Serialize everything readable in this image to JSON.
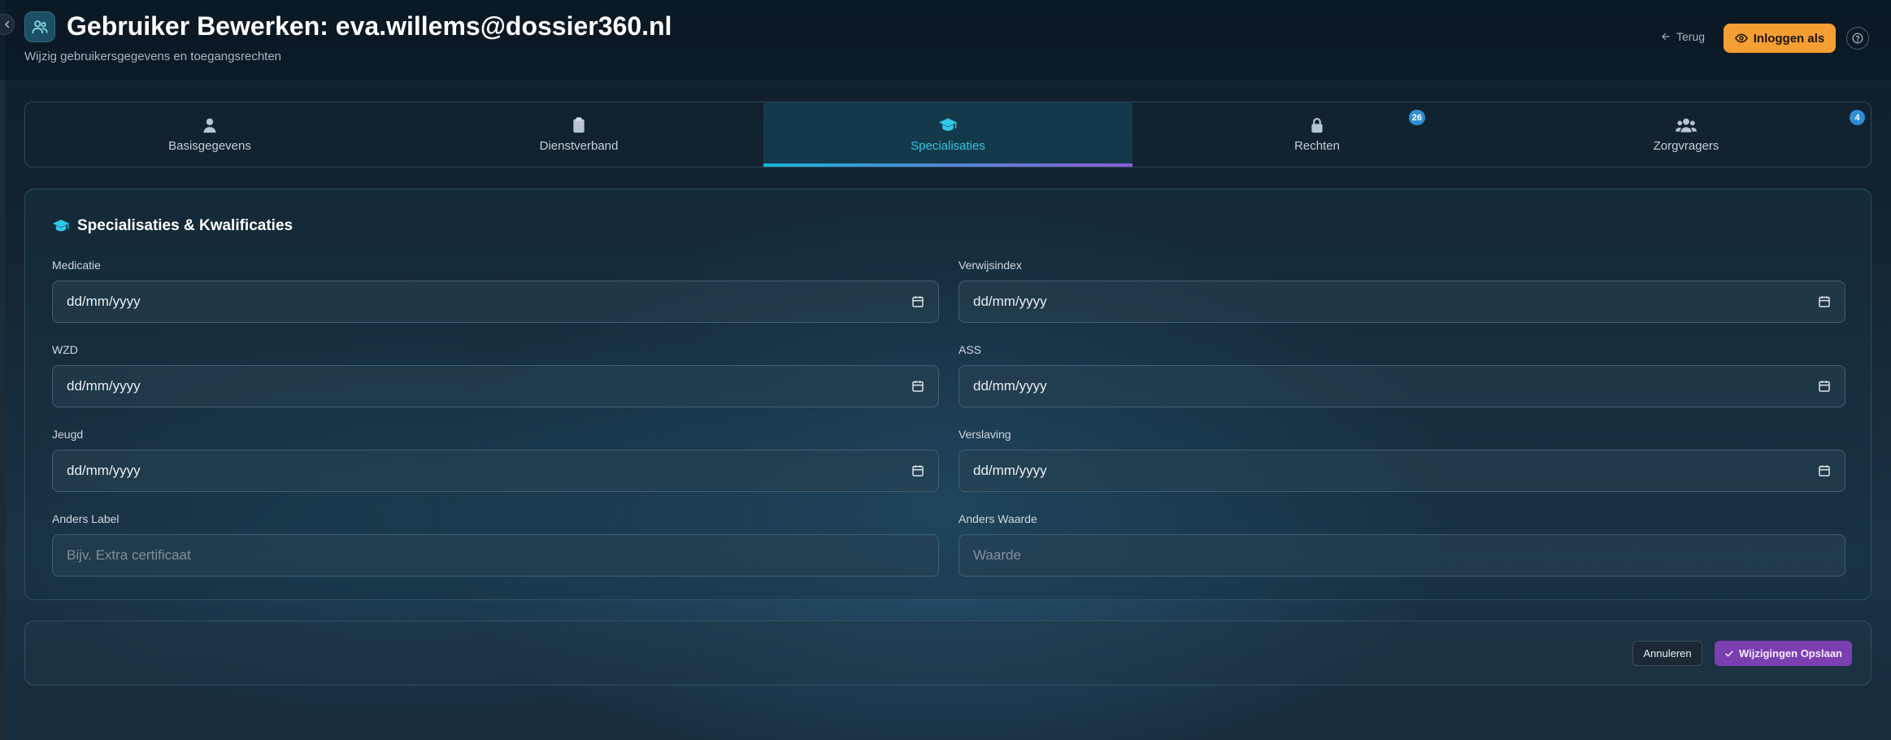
{
  "header": {
    "title": "Gebruiker Bewerken: eva.willems@dossier360.nl",
    "subtitle": "Wijzig gebruikersgegevens en toegangsrechten",
    "back_label": "Terug",
    "login_as_label": "Inloggen als"
  },
  "tabs": [
    {
      "label": "Basisgegevens",
      "icon": "user-icon"
    },
    {
      "label": "Dienstverband",
      "icon": "clipboard-icon"
    },
    {
      "label": "Specialisaties",
      "icon": "graduation-cap-icon",
      "active": true
    },
    {
      "label": "Rechten",
      "icon": "lock-icon",
      "badge": "26"
    },
    {
      "label": "Zorgvragers",
      "icon": "users-icon",
      "badge": "4"
    }
  ],
  "section": {
    "title": "Specialisaties & Kwalificaties",
    "fields": [
      {
        "label": "Medicatie",
        "value": "dd/mm/yyyy"
      },
      {
        "label": "Verwijsindex",
        "value": "dd/mm/yyyy"
      },
      {
        "label": "WZD",
        "value": "dd/mm/yyyy"
      },
      {
        "label": "ASS",
        "value": "dd/mm/yyyy"
      },
      {
        "label": "Jeugd",
        "value": "dd/mm/yyyy"
      },
      {
        "label": "Verslaving",
        "value": "dd/mm/yyyy"
      },
      {
        "label": "Anders Label",
        "placeholder": "Bijv. Extra certificaat"
      },
      {
        "label": "Anders Waarde",
        "placeholder": "Waarde"
      }
    ]
  },
  "actions": {
    "cancel_label": "Annuleren",
    "save_label": "Wijzigingen Opslaan"
  },
  "colors": {
    "accent": "#2ec8e6",
    "primary_orange": "#f59e33",
    "save_purple": "#7b3fb1",
    "badge_blue": "#2f8ed6"
  }
}
